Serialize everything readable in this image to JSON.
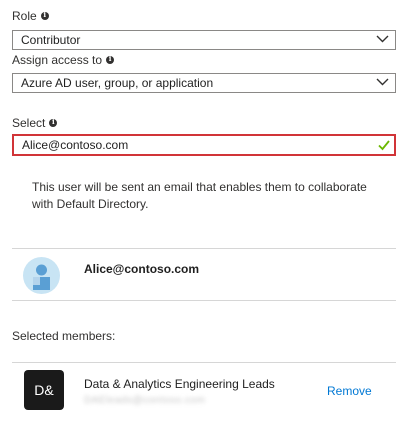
{
  "role": {
    "label": "Role",
    "value": "Contributor"
  },
  "assign_access": {
    "label": "Assign access to",
    "value": "Azure AD user, group, or application"
  },
  "select": {
    "label": "Select",
    "value": "Alice@contoso.com"
  },
  "note": "This user will be sent an email that enables them to collaborate with Default Directory.",
  "search_result": {
    "name": "Alice@contoso.com"
  },
  "selected_members": {
    "title": "Selected members:",
    "items": [
      {
        "initials": "D&",
        "name": "Data & Analytics Engineering Leads",
        "email": "DAEleads@contoso.com",
        "remove_label": "Remove"
      }
    ]
  },
  "colors": {
    "accent": "#0078d4",
    "error_border": "#d13438",
    "valid_check": "#107c10"
  }
}
